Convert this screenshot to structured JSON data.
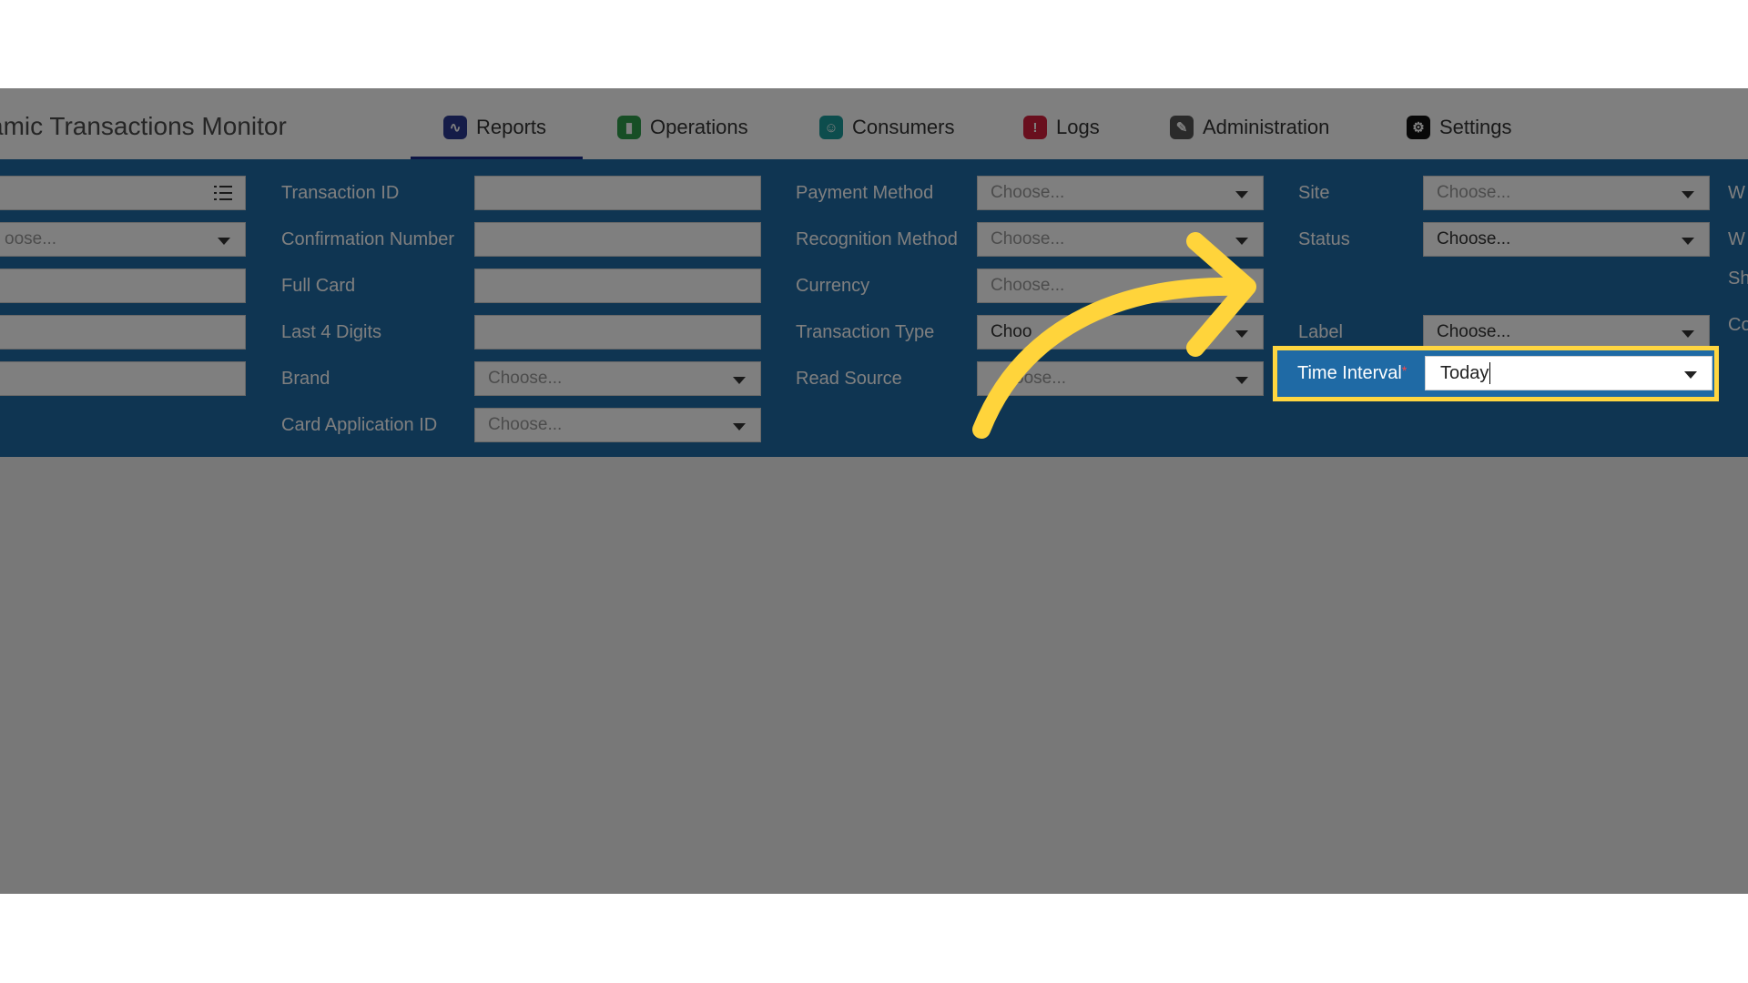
{
  "app": {
    "title": "amic Transactions Monitor"
  },
  "tabs": [
    {
      "label": "Reports",
      "icon": "reports-icon",
      "color": "#2b3990"
    },
    {
      "label": "Operations",
      "icon": "operations-icon",
      "color": "#2e9c4a"
    },
    {
      "label": "Consumers",
      "icon": "consumers-icon",
      "color": "#1a9a9a"
    },
    {
      "label": "Logs",
      "icon": "logs-icon",
      "color": "#d21f3c"
    },
    {
      "label": "Administration",
      "icon": "administration-icon",
      "color": "#555555"
    },
    {
      "label": "Settings",
      "icon": "settings-icon",
      "color": "#111111"
    }
  ],
  "filters": {
    "col0": {
      "placeholder_choose": "oose..."
    },
    "transaction_id": {
      "label": "Transaction ID"
    },
    "confirmation_number": {
      "label": "Confirmation Number"
    },
    "full_card": {
      "label": "Full Card"
    },
    "last4": {
      "label": "Last 4 Digits"
    },
    "brand": {
      "label": "Brand",
      "value": "Choose..."
    },
    "card_app_id": {
      "label": "Card Application ID",
      "value": "Choose..."
    },
    "payment_method": {
      "label": "Payment Method",
      "value": "Choose..."
    },
    "recognition_method": {
      "label": "Recognition Method",
      "value": "Choose..."
    },
    "currency": {
      "label": "Currency",
      "value": "Choose..."
    },
    "transaction_type": {
      "label": "Transaction Type",
      "value": "Choo"
    },
    "read_source": {
      "label": "Read Source",
      "value": "oose..."
    },
    "site": {
      "label": "Site",
      "value": "Choose..."
    },
    "status": {
      "label": "Status",
      "value": "Choose..."
    },
    "time_interval": {
      "label": "Time Interval",
      "required_mark": "*",
      "value": "Today"
    },
    "label": {
      "label": "Label",
      "value": "Choose..."
    },
    "right_cut": [
      "W",
      "W",
      "Sh",
      "Co"
    ]
  },
  "colors": {
    "panel": "#1f6aa5",
    "highlight": "#ffd640",
    "arrow": "#ffd43b"
  }
}
